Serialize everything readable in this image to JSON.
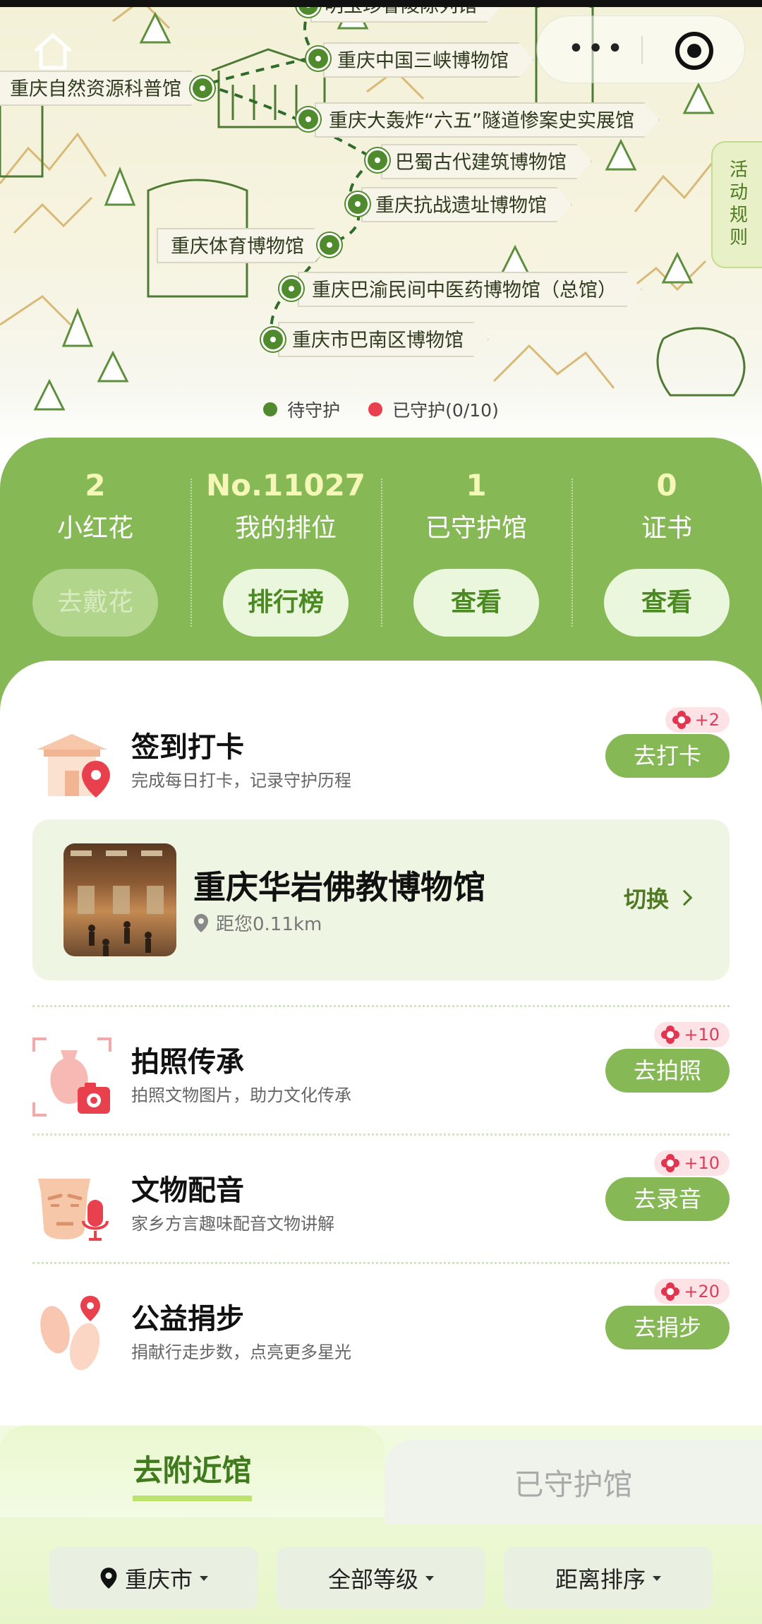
{
  "map": {
    "route_labels": [
      "明玉珍睿陵陈列馆",
      "重庆中国三峡博物馆",
      "重庆自然资源科普馆",
      "重庆大轰炸“六五”隧道惨案史实展馆",
      "巴蜀古代建筑博物馆",
      "重庆抗战遗址博物馆",
      "重庆体育博物馆",
      "重庆巴渝民间中医药博物馆（总馆）",
      "重庆市巴南区博物馆"
    ],
    "rules_tab": "活动规则",
    "legend": [
      {
        "label": "待守护",
        "color": "#4f8a2c"
      },
      {
        "label": "已守护(0/10)",
        "color": "#e8414d"
      }
    ]
  },
  "capsule": {
    "more": "•••"
  },
  "stats": [
    {
      "value": "2",
      "label": "小红花",
      "button": "去戴花"
    },
    {
      "value": "No.11027",
      "label": "我的排位",
      "button": "排行榜"
    },
    {
      "value": "1",
      "label": "已守护馆",
      "button": "查看"
    },
    {
      "value": "0",
      "label": "证书",
      "button": "查看"
    }
  ],
  "tasks": [
    {
      "name": "签到打卡",
      "desc": "完成每日打卡，记录守护历程",
      "reward": "+2",
      "button": "去打卡",
      "icon": "temple-pin-icon"
    },
    {
      "name": "拍照传承",
      "desc": "拍照文物图片，助力文化传承",
      "reward": "+10",
      "button": "去拍照",
      "icon": "vase-camera-icon"
    },
    {
      "name": "文物配音",
      "desc": "家乡方言趣味配音文物讲解",
      "reward": "+10",
      "button": "去录音",
      "icon": "mask-mic-icon"
    },
    {
      "name": "公益捐步",
      "desc": "捐献行走步数，点亮更多星光",
      "reward": "+20",
      "button": "去捐步",
      "icon": "footprint-icon"
    }
  ],
  "current_museum": {
    "name": "重庆华岩佛教博物馆",
    "distance": "距您0.11km",
    "switch": "切换"
  },
  "tabs": {
    "active": "去附近馆",
    "inactive": "已守护馆"
  },
  "filters": [
    "重庆市",
    "全部等级",
    "距离排序"
  ],
  "colors": {
    "primary_green": "#86b956",
    "dark_green": "#4f8a2c",
    "reward_red": "#e23550"
  }
}
